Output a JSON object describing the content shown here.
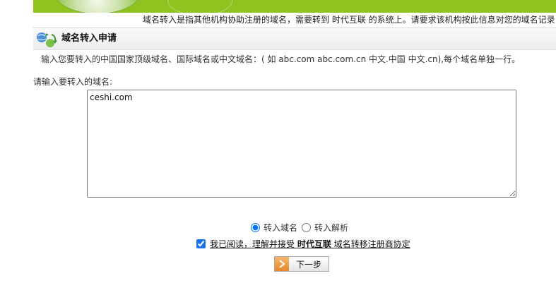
{
  "notice": {
    "text": "域名转入是指其他机构协助注册的域名，需要转到 时代互联 的系统上。请要求该机构按此信息对您的域名记录"
  },
  "section": {
    "title": "域名转入申请",
    "icon": "domain-transfer-icon"
  },
  "form": {
    "instruction": "输入您要转入的中国国家顶级域名、国际域名或中文域名：( 如 abc.com abc.com.cn 中文.中国 中文.cn),每个域名单独一行。",
    "domain_label": "请输入要转入的域名:",
    "domain_value": "ceshi.com",
    "options": [
      {
        "label": "转入域名",
        "selected": true
      },
      {
        "label": "转入解析",
        "selected": false
      }
    ],
    "agreement": {
      "prefix": "我已阅读，理解并接受 ",
      "brand": "时代互联",
      "suffix": " 域名转移注册商协定",
      "checked": true
    },
    "next_label": "下一步"
  },
  "colors": {
    "banner_green": "#8fc31f",
    "button_arrow_orange": "#e8862a"
  }
}
